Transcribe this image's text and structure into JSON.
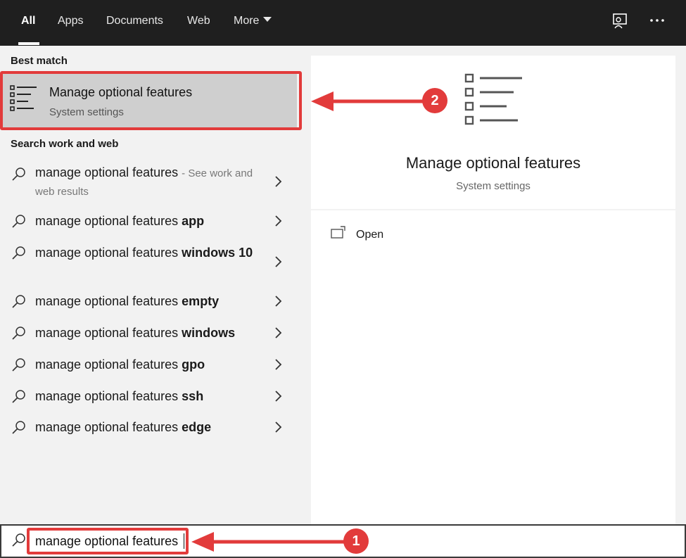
{
  "nav": {
    "tabs": [
      {
        "label": "All",
        "active": true
      },
      {
        "label": "Apps"
      },
      {
        "label": "Documents"
      },
      {
        "label": "Web"
      },
      {
        "label": "More"
      }
    ]
  },
  "left": {
    "best_match_heading": "Best match",
    "best_match": {
      "title": "Manage optional features",
      "subtitle": "System settings",
      "icon": "list-icon"
    },
    "search_heading": "Search work and web",
    "results": [
      {
        "query": "manage optional features",
        "suffix": "",
        "hint": "- See work and web results"
      },
      {
        "query": "manage optional features",
        "suffix": "app"
      },
      {
        "query": "manage optional features",
        "suffix": "windows 10"
      },
      {
        "query": "manage optional features",
        "suffix": "empty"
      },
      {
        "query": "manage optional features",
        "suffix": "windows"
      },
      {
        "query": "manage optional features",
        "suffix": "gpo"
      },
      {
        "query": "manage optional features",
        "suffix": "ssh"
      },
      {
        "query": "manage optional features",
        "suffix": "edge"
      }
    ]
  },
  "right": {
    "app_title": "Manage optional features",
    "app_subtitle": "System settings",
    "actions": [
      {
        "label": "Open",
        "icon": "open-window-icon"
      }
    ]
  },
  "search": {
    "value": "manage optional features"
  },
  "annotations": {
    "badge1": "1",
    "badge2": "2",
    "color": "#e23b3b"
  }
}
